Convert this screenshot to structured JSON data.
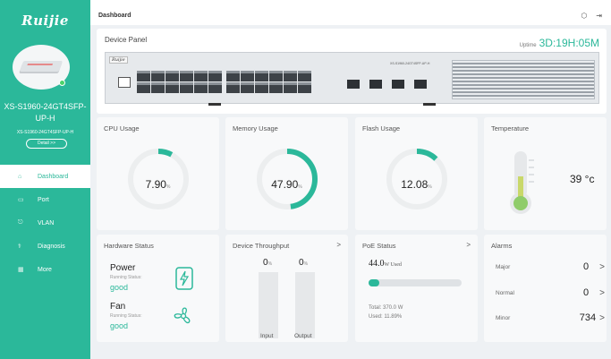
{
  "sidebar": {
    "logo": "Ruijie",
    "device_name": "XS-S1960-24GT4SFP-UP-H",
    "device_model": "XS-S1960-24GT4SFP-UP-H",
    "detail_label": "Detail >>",
    "items": [
      {
        "label": "Dashboard",
        "icon": "home-icon",
        "glyph": "⌂",
        "active": true
      },
      {
        "label": "Port",
        "icon": "port-icon",
        "glyph": "▭"
      },
      {
        "label": "VLAN",
        "icon": "vlan-icon",
        "glyph": "⎋"
      },
      {
        "label": "Diagnosis",
        "icon": "diagnosis-icon",
        "glyph": "⚕"
      },
      {
        "label": "More",
        "icon": "more-icon",
        "glyph": "▦"
      }
    ]
  },
  "header": {
    "title": "Dashboard",
    "icons": [
      "cube-icon",
      "logout-icon"
    ]
  },
  "device_panel": {
    "title": "Device Panel",
    "uptime_label": "Uptime",
    "uptime_value": "3D:19H:05M",
    "switch_brand": "Ruijie",
    "switch_model": "XS-S1960-24GT4SFP-UP-H"
  },
  "cpu": {
    "title": "CPU Usage",
    "value": "7.90",
    "unit": "%",
    "percent": 7.9
  },
  "memory": {
    "title": "Memory Usage",
    "value": "47.90",
    "unit": "%",
    "percent": 47.9
  },
  "flash": {
    "title": "Flash Usage",
    "value": "12.08",
    "unit": "%",
    "percent": 12.08
  },
  "temperature": {
    "title": "Temperature",
    "value": "39 °c"
  },
  "hardware": {
    "title": "Hardware Status",
    "power": {
      "name": "Power",
      "sub": "Running Status:",
      "state": "good"
    },
    "fan": {
      "name": "Fan",
      "sub": "Running Status:",
      "state": "good"
    }
  },
  "throughput": {
    "title": "Device Throughput",
    "input_value": "0",
    "output_value": "0",
    "unit": "%",
    "input_label": "Input",
    "output_label": "Output"
  },
  "poe": {
    "title": "PoE Status",
    "used_value": "44.0",
    "used_unit": "W Used",
    "percent": 11.89,
    "total": "Total: 370.0 W",
    "used": "Used: 11.89%"
  },
  "alarms": {
    "title": "Alarms",
    "rows": [
      {
        "name": "Major",
        "count": "0"
      },
      {
        "name": "Normal",
        "count": "0"
      },
      {
        "name": "Minor",
        "count": "734"
      }
    ]
  },
  "colors": {
    "accent": "#2bb89a",
    "gauge_track": "#eceeef"
  }
}
